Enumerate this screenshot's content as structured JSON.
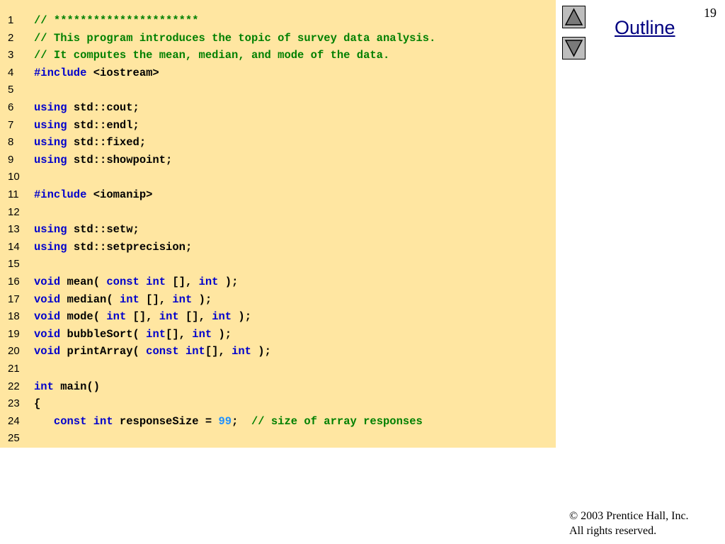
{
  "slide_number": "19",
  "outline_label": "Outline",
  "nav": {
    "up_icon": "triangle-up-icon",
    "down_icon": "triangle-down-icon"
  },
  "copyright": {
    "line1": "© 2003 Prentice Hall, Inc.",
    "line2": "All rights reserved."
  },
  "colors": {
    "code_background": "#ffe6a1",
    "keyword": "#0000cc",
    "comment": "#008000",
    "number": "#1e90ff",
    "outline_link": "#000080"
  },
  "code_lines": [
    {
      "num": "1",
      "tokens": [
        {
          "t": "comment",
          "s": "// **********************"
        }
      ]
    },
    {
      "num": "2",
      "tokens": [
        {
          "t": "comment",
          "s": "// This program introduces the topic of survey data analysis."
        }
      ]
    },
    {
      "num": "3",
      "tokens": [
        {
          "t": "comment",
          "s": "// It computes the mean, median, and mode of the data."
        }
      ]
    },
    {
      "num": "4",
      "tokens": [
        {
          "t": "keyword",
          "s": "#include"
        },
        {
          "t": "plain",
          "s": " <iostream>"
        }
      ]
    },
    {
      "num": "5",
      "tokens": []
    },
    {
      "num": "6",
      "tokens": [
        {
          "t": "keyword",
          "s": "using"
        },
        {
          "t": "plain",
          "s": " std::cout;"
        }
      ]
    },
    {
      "num": "7",
      "tokens": [
        {
          "t": "keyword",
          "s": "using"
        },
        {
          "t": "plain",
          "s": " std::endl;"
        }
      ]
    },
    {
      "num": "8",
      "tokens": [
        {
          "t": "keyword",
          "s": "using"
        },
        {
          "t": "plain",
          "s": " std::fixed;"
        }
      ]
    },
    {
      "num": "9",
      "tokens": [
        {
          "t": "keyword",
          "s": "using"
        },
        {
          "t": "plain",
          "s": " std::showpoint;"
        }
      ]
    },
    {
      "num": "10",
      "tokens": []
    },
    {
      "num": "11",
      "tokens": [
        {
          "t": "keyword",
          "s": "#include"
        },
        {
          "t": "plain",
          "s": " <iomanip>"
        }
      ]
    },
    {
      "num": "12",
      "tokens": []
    },
    {
      "num": "13",
      "tokens": [
        {
          "t": "keyword",
          "s": "using"
        },
        {
          "t": "plain",
          "s": " std::setw;"
        }
      ]
    },
    {
      "num": "14",
      "tokens": [
        {
          "t": "keyword",
          "s": "using"
        },
        {
          "t": "plain",
          "s": " std::setprecision;"
        }
      ]
    },
    {
      "num": "15",
      "tokens": []
    },
    {
      "num": "16",
      "tokens": [
        {
          "t": "keyword",
          "s": "void"
        },
        {
          "t": "plain",
          "s": " mean( "
        },
        {
          "t": "keyword",
          "s": "const int"
        },
        {
          "t": "plain",
          "s": " [], "
        },
        {
          "t": "keyword",
          "s": "int"
        },
        {
          "t": "plain",
          "s": " );"
        }
      ]
    },
    {
      "num": "17",
      "tokens": [
        {
          "t": "keyword",
          "s": "void"
        },
        {
          "t": "plain",
          "s": " median( "
        },
        {
          "t": "keyword",
          "s": "int"
        },
        {
          "t": "plain",
          "s": " [], "
        },
        {
          "t": "keyword",
          "s": "int"
        },
        {
          "t": "plain",
          "s": " );"
        }
      ]
    },
    {
      "num": "18",
      "tokens": [
        {
          "t": "keyword",
          "s": "void"
        },
        {
          "t": "plain",
          "s": " mode( "
        },
        {
          "t": "keyword",
          "s": "int"
        },
        {
          "t": "plain",
          "s": " [], "
        },
        {
          "t": "keyword",
          "s": "int"
        },
        {
          "t": "plain",
          "s": " [], "
        },
        {
          "t": "keyword",
          "s": "int"
        },
        {
          "t": "plain",
          "s": " );"
        }
      ]
    },
    {
      "num": "19",
      "tokens": [
        {
          "t": "keyword",
          "s": "void"
        },
        {
          "t": "plain",
          "s": " bubbleSort( "
        },
        {
          "t": "keyword",
          "s": "int"
        },
        {
          "t": "plain",
          "s": "[], "
        },
        {
          "t": "keyword",
          "s": "int"
        },
        {
          "t": "plain",
          "s": " );"
        }
      ]
    },
    {
      "num": "20",
      "tokens": [
        {
          "t": "keyword",
          "s": "void"
        },
        {
          "t": "plain",
          "s": " printArray( "
        },
        {
          "t": "keyword",
          "s": "const int"
        },
        {
          "t": "plain",
          "s": "[], "
        },
        {
          "t": "keyword",
          "s": "int"
        },
        {
          "t": "plain",
          "s": " );"
        }
      ]
    },
    {
      "num": "21",
      "tokens": []
    },
    {
      "num": "22",
      "tokens": [
        {
          "t": "keyword",
          "s": "int"
        },
        {
          "t": "plain",
          "s": " main()"
        }
      ]
    },
    {
      "num": "23",
      "tokens": [
        {
          "t": "plain",
          "s": "{"
        }
      ]
    },
    {
      "num": "24",
      "tokens": [
        {
          "t": "plain",
          "s": "   "
        },
        {
          "t": "keyword",
          "s": "const int"
        },
        {
          "t": "plain",
          "s": " responseSize = "
        },
        {
          "t": "number",
          "s": "99"
        },
        {
          "t": "plain",
          "s": ";  "
        },
        {
          "t": "comment",
          "s": "// size of array responses"
        }
      ]
    },
    {
      "num": "25",
      "tokens": []
    }
  ]
}
